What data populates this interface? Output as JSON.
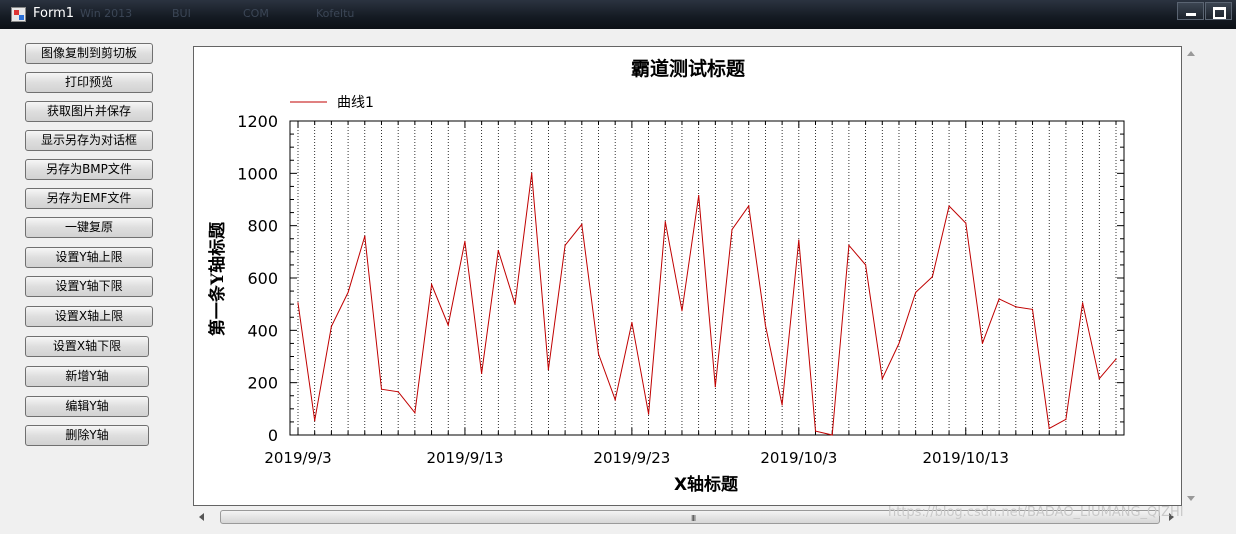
{
  "window": {
    "title": "Form1",
    "taskbar_ghost": [
      "Win 2013",
      "BUI",
      "COM",
      "Kofeltu"
    ]
  },
  "buttons": [
    {
      "label": "图像复制到剪切板",
      "name": "copy-image-button"
    },
    {
      "label": "打印预览",
      "name": "print-preview-button"
    },
    {
      "label": "获取图片并保存",
      "name": "save-image-button"
    },
    {
      "label": "显示另存为对话框",
      "name": "save-as-dialog-button"
    },
    {
      "label": "另存为BMP文件",
      "name": "save-bmp-button"
    },
    {
      "label": "另存为EMF文件",
      "name": "save-emf-button"
    },
    {
      "label": "一键复原",
      "name": "reset-button"
    },
    {
      "label": "设置Y轴上限",
      "name": "set-y-max-button"
    },
    {
      "label": "设置Y轴下限",
      "name": "set-y-min-button"
    },
    {
      "label": "设置X轴上限",
      "name": "set-x-max-button"
    },
    {
      "label": "设置X轴下限",
      "name": "set-x-min-button"
    },
    {
      "label": "新增Y轴",
      "name": "add-y-axis-button"
    },
    {
      "label": "编辑Y轴",
      "name": "edit-y-axis-button"
    },
    {
      "label": "删除Y轴",
      "name": "delete-y-axis-button"
    }
  ],
  "scrollbar": {
    "grip": "III"
  },
  "watermark": "https://blog.csdn.net/BADAO_LIUMANG_QIZHI",
  "colors": {
    "series": "#c00000",
    "axis": "#000000",
    "grid": "#000000"
  },
  "chart_data": {
    "type": "line",
    "title": "霸道测试标题",
    "xlabel": "X轴标题",
    "ylabel": "第一条Y轴标题",
    "ylim": [
      0,
      1200
    ],
    "yticks": [
      "0",
      "200",
      "400",
      "600",
      "800",
      "1000",
      "1200"
    ],
    "x_start": "2019-09-03",
    "x_end": "2019-10-22",
    "xtick_labels": [
      "2019/9/3",
      "2019/9/13",
      "2019/9/23",
      "2019/10/3",
      "2019/10/13"
    ],
    "grid": {
      "x": true,
      "y": false
    },
    "legend_position": "top-left",
    "series": [
      {
        "name": "曲线1",
        "x": [
          "2019-09-03",
          "2019-09-04",
          "2019-09-05",
          "2019-09-06",
          "2019-09-07",
          "2019-09-08",
          "2019-09-09",
          "2019-09-10",
          "2019-09-11",
          "2019-09-12",
          "2019-09-13",
          "2019-09-14",
          "2019-09-15",
          "2019-09-16",
          "2019-09-17",
          "2019-09-18",
          "2019-09-19",
          "2019-09-20",
          "2019-09-21",
          "2019-09-22",
          "2019-09-23",
          "2019-09-24",
          "2019-09-25",
          "2019-09-26",
          "2019-09-27",
          "2019-09-28",
          "2019-09-29",
          "2019-09-30",
          "2019-10-01",
          "2019-10-02",
          "2019-10-03",
          "2019-10-04",
          "2019-10-05",
          "2019-10-06",
          "2019-10-07",
          "2019-10-08",
          "2019-10-09",
          "2019-10-10",
          "2019-10-11",
          "2019-10-12",
          "2019-10-13",
          "2019-10-14",
          "2019-10-15",
          "2019-10-16",
          "2019-10-17",
          "2019-10-18",
          "2019-10-19",
          "2019-10-20",
          "2019-10-21",
          "2019-10-22"
        ],
        "values": [
          505,
          55,
          415,
          545,
          760,
          175,
          165,
          85,
          575,
          420,
          740,
          235,
          705,
          500,
          1000,
          250,
          725,
          805,
          310,
          135,
          430,
          80,
          815,
          475,
          915,
          185,
          785,
          875,
          420,
          115,
          745,
          15,
          0,
          725,
          650,
          215,
          350,
          545,
          605,
          875,
          810,
          350,
          520,
          490,
          480,
          25,
          60,
          505,
          215,
          290
        ]
      }
    ]
  }
}
